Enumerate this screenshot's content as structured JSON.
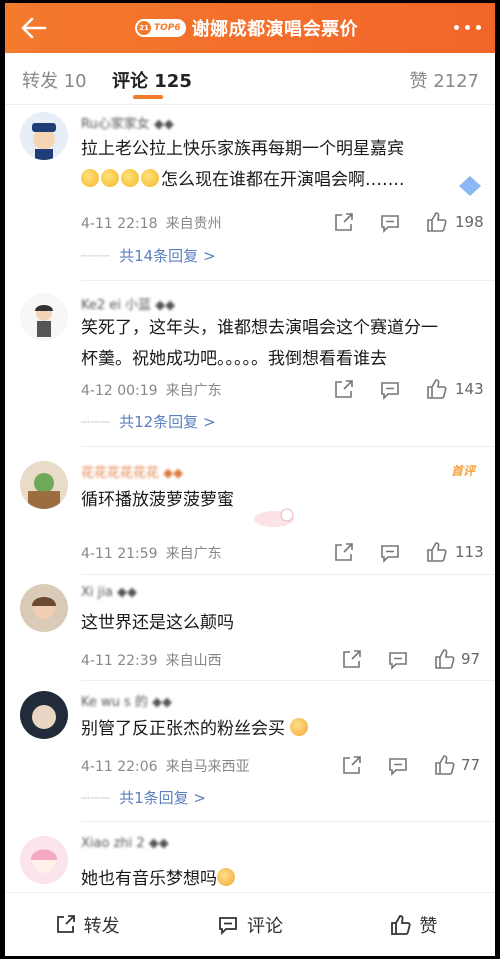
{
  "header": {
    "title": "谢娜成都演唱会票价",
    "badge": "TOP6",
    "badge_num": "21",
    "back_icon": "back-arrow-icon",
    "more_icon": "more-dots-icon"
  },
  "tabs": {
    "repost": "转发 10",
    "comment": "评论 125",
    "like": "赞 2127"
  },
  "comments": [
    {
      "name": "Ru心家家女 ◆◆",
      "text_line1": "拉上老公拉上快乐家族再每期一个明星嘉宾",
      "text_line2": "怎么现在谁都在开演唱会啊…….",
      "time": "4-11 22:18",
      "location": "来自贵州",
      "likes": "198",
      "replies": "共14条回复 >"
    },
    {
      "name": "Ke2 ei 小蓝 ◆◆",
      "text_line1": "笑死了，这年头，谁都想去演唱会这个赛道分一",
      "text_line2": "杯羹。祝她成功吧。。。。。我倒想看看谁去",
      "time": "4-12 00:19",
      "location": "来自广东",
      "likes": "143",
      "replies": "共12条回复 >"
    },
    {
      "name": "花花花花花花 ◆◆",
      "text_line1": "循环播放菠萝菠萝蜜",
      "time": "4-11 21:59",
      "location": "来自广东",
      "likes": "113",
      "first_badge": "首评"
    },
    {
      "name": "Xi jia ◆◆",
      "text_line1": "这世界还是这么颠吗",
      "time": "4-11 22:39",
      "location": "来自山西",
      "likes": "97"
    },
    {
      "name": "Ke wu s 的 ◆◆",
      "text_line1": "别管了反正张杰的粉丝会买",
      "time": "4-11 22:06",
      "location": "来自马来西亚",
      "likes": "77",
      "replies": "共1条回复 >"
    },
    {
      "name": "Xiao zhi 2 ◆◆",
      "text_line1": "她也有音乐梦想吗"
    }
  ],
  "bottom_bar": {
    "repost": "转发",
    "comment": "评论",
    "like": "赞"
  },
  "colors": {
    "accent": "#f47a2c",
    "link": "#5b7fbf"
  }
}
